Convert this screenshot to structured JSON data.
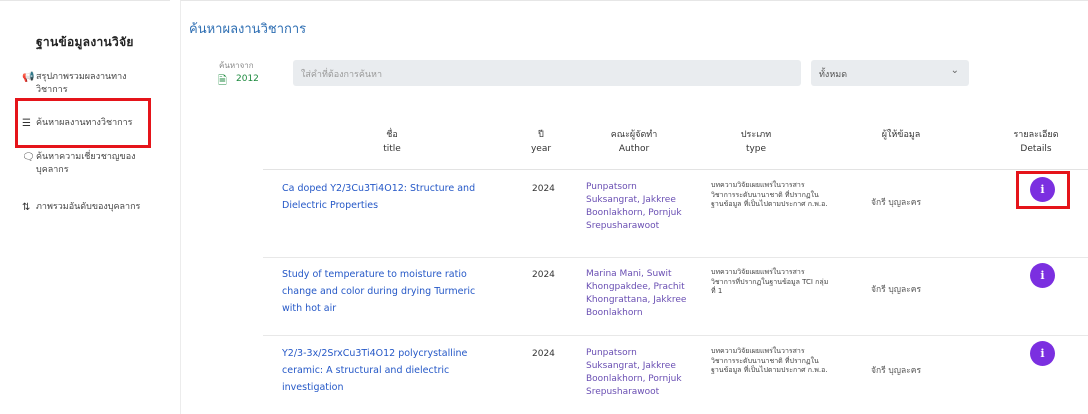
{
  "sidebar": {
    "title": "ฐานข้อมูลงานวิจัย",
    "items": [
      {
        "icon": "megaphone-icon",
        "glyph": "📢",
        "label": "สรุปภาพรวมผลงานทางวิชาการ"
      },
      {
        "icon": "list-icon",
        "glyph": "☰",
        "label": "ค้นหาผลงานทางวิชาการ"
      },
      {
        "icon": "expert-search-icon",
        "glyph": "🗨",
        "label": "ค้นหาความเชี่ยวชาญของบุคลากร"
      },
      {
        "icon": "sort-icon",
        "glyph": "⇅",
        "label": "ภาพรวมอันดับของบุคลากร"
      }
    ]
  },
  "main": {
    "page_title": "ค้นหาผลงานวิชาการ",
    "filter": {
      "year_label": "ค้นหาจาก",
      "year_value": "2012",
      "search_placeholder": "ใส่คำที่ต้องการค้นหา",
      "select_value": "ทั้งหมด"
    },
    "table": {
      "headers": [
        {
          "th": "ชื่อ",
          "en": "title"
        },
        {
          "th": "ปี",
          "en": "year"
        },
        {
          "th": "คณะผู้จัดทำ",
          "en": "Author"
        },
        {
          "th": "ประเภท",
          "en": "type"
        },
        {
          "th": "ผู้ให้ข้อมูล",
          "en": ""
        },
        {
          "th": "รายละเอียด",
          "en": "Details"
        }
      ],
      "rows": [
        {
          "title": "Ca doped Y2/3Cu3Ti4O12: Structure and Dielectric Properties",
          "year": "2024",
          "author": "Punpatsorn Suksangrat, Jakkree Boonlakhorn, Pornjuk Srepusharawoot",
          "type": "บทความวิจัยเผยแพร่ในวารสารวิชาการระดับนานาชาติ ที่ปรากฏในฐานข้อมูล ที่เป็นไปตามประกาศ ก.พ.อ.",
          "provider": "จักรี บุญละคร",
          "details_icon": "i"
        },
        {
          "title": "Study of temperature to moisture ratio change and color during drying Turmeric with hot air",
          "year": "2024",
          "author": "Marina Mani, Suwit Khongpakdee, Prachit Khongrattana, Jakkree Boonlakhorn",
          "type": "บทความวิจัยเผยแพร่ในวารสารวิชาการที่ปรากฏในฐานข้อมูล TCI กลุ่มที่ 1",
          "provider": "จักรี บุญละคร",
          "details_icon": "i"
        },
        {
          "title": "Y2/3-3x/2SrxCu3Ti4O12 polycrystalline ceramic: A structural and dielectric investigation",
          "year": "2024",
          "author": "Punpatsorn Suksangrat, Jakkree Boonlakhorn, Pornjuk Srepusharawoot",
          "type": "บทความวิจัยเผยแพร่ในวารสารวิชาการระดับนานาชาติ ที่ปรากฏในฐานข้อมูล ที่เป็นไปตามประกาศ ก.พ.อ.",
          "provider": "จักรี บุญละคร",
          "details_icon": "i"
        }
      ]
    }
  },
  "colors": {
    "accent": "#2f6fb3",
    "link": "#2558c7",
    "author": "#6a4fb3",
    "button": "#7b2fe0",
    "highlight": "#e5141a",
    "year_filter": "#1d8a3f"
  }
}
